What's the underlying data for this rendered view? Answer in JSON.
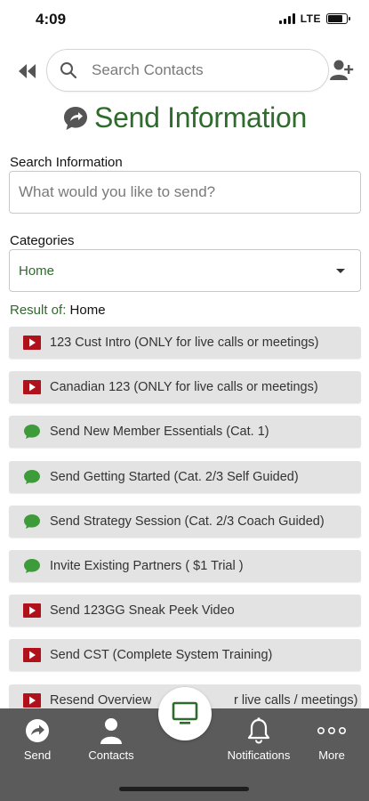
{
  "status_bar": {
    "time": "4:09",
    "network": "LTE"
  },
  "header": {
    "search_placeholder": "Search Contacts",
    "title": "Send Information"
  },
  "search_info": {
    "label": "Search Information",
    "placeholder": "What would you like to send?"
  },
  "categories": {
    "label": "Categories",
    "selected": "Home"
  },
  "results": {
    "prefix": "Result of:",
    "category": "Home",
    "items": [
      {
        "label": "123 Cust Intro (ONLY for live calls or meetings)",
        "icon": "video-play-icon"
      },
      {
        "label": "Canadian 123 (ONLY for live calls or meetings)",
        "icon": "video-play-icon"
      },
      {
        "label": "Send New Member Essentials (Cat. 1)",
        "icon": "chat-bubble-icon"
      },
      {
        "label": "Send Getting Started (Cat. 2/3 Self Guided)",
        "icon": "chat-bubble-icon"
      },
      {
        "label": "Send Strategy Session (Cat. 2/3 Coach Guided)",
        "icon": "chat-bubble-icon"
      },
      {
        "label": "Invite Existing Partners ( $1 Trial )",
        "icon": "chat-bubble-icon"
      },
      {
        "label": "Send 123GG Sneak Peek Video",
        "icon": "video-play-icon"
      },
      {
        "label": "Send CST (Complete System Training)",
        "icon": "video-play-icon"
      },
      {
        "label": "Resend Overview",
        "label_tail": "r live calls / meetings)",
        "icon": "video-play-icon"
      }
    ]
  },
  "bottom_nav": {
    "send": "Send",
    "contacts": "Contacts",
    "notifications": "Notifications",
    "more": "More"
  },
  "colors": {
    "brand_green": "#2e6b2c",
    "video_red": "#b0121b",
    "chat_green": "#3e9b3a",
    "nav_bg": "#5b5b5b"
  }
}
